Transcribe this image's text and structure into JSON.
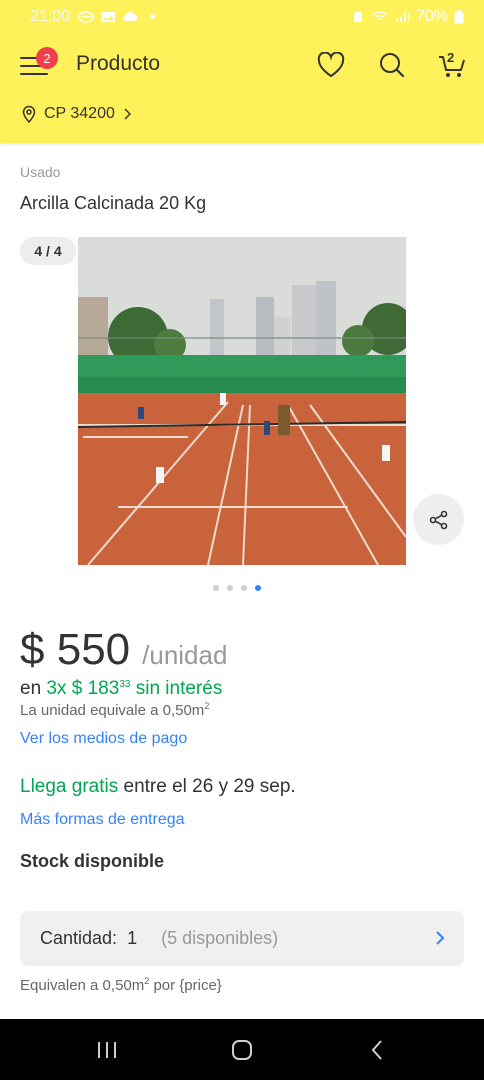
{
  "status_bar": {
    "time": "21:00",
    "battery": "70%"
  },
  "header": {
    "title": "Producto",
    "menu_badge": "2",
    "cart_count": "2",
    "postal_code": "CP 34200"
  },
  "product": {
    "condition": "Usado",
    "title": "Arcilla Calcinada 20 Kg",
    "image_counter": "4 / 4",
    "image_description": "tennis-clay-court-photo",
    "carousel": {
      "total": 4,
      "active": 4
    }
  },
  "pricing": {
    "currency": "$",
    "amount": "550",
    "unit": "/unidad",
    "installments_prefix": "en",
    "installments_plan": "3x $ 183",
    "installments_cents": "33",
    "installments_suffix": "sin interés",
    "unit_equiv": "La unidad equivale a 0,50m",
    "unit_equiv_exp": "2",
    "payment_link": "Ver los medios de pago"
  },
  "shipping": {
    "free_label": "Llega gratis",
    "dates": "entre el 26 y 29 sep.",
    "more_link": "Más formas de entrega"
  },
  "stock": {
    "label": "Stock disponible",
    "quantity_label": "Cantidad:",
    "quantity_value": "1",
    "available": "(5 disponibles)",
    "equiv_prefix": "Equivalen a 0,50m",
    "equiv_exp": "2",
    "equiv_suffix": "por {price}"
  },
  "colors": {
    "brand_yellow": "#fff159",
    "link_blue": "#3483fa",
    "green": "#00a650",
    "badge_red": "#f23d4f"
  }
}
